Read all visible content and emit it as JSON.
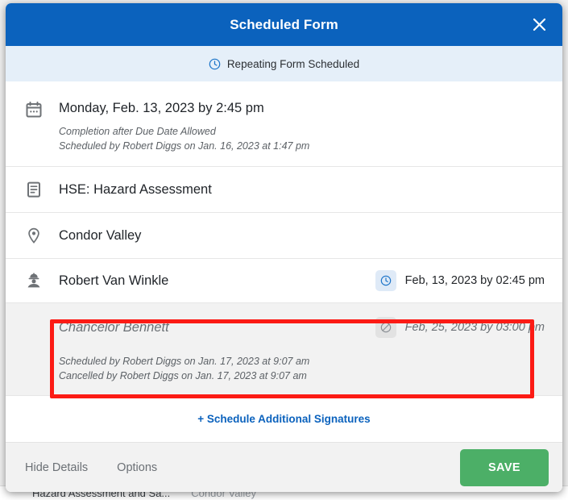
{
  "modal": {
    "title": "Scheduled Form",
    "close_icon": "close-icon",
    "status_banner": {
      "icon": "clock-icon",
      "text": "Repeating Form Scheduled"
    },
    "rows": {
      "date": {
        "icon": "calendar-icon",
        "title": "Monday, Feb. 13, 2023 by 2:45 pm",
        "note_1": "Completion after Due Date Allowed",
        "note_2": "Scheduled by Robert Diggs on Jan. 16, 2023 at 1:47 pm"
      },
      "form": {
        "icon": "form-document-icon",
        "title": "HSE: Hazard Assessment"
      },
      "location": {
        "icon": "map-pin-icon",
        "title": "Condor Valley"
      },
      "signature_active": {
        "icon": "hard-hat-worker-icon",
        "name": "Robert Van Winkle",
        "status_icon": "clock-icon",
        "stamp": "Feb, 13, 2023 by 02:45 pm"
      },
      "signature_cancelled": {
        "name": "Chancelor Bennett",
        "status_icon": "cancelled-circle-slash-icon",
        "stamp": "Feb, 25, 2023 by 03:00 pm",
        "note_1": "Scheduled by Robert Diggs on Jan. 17, 2023 at 9:07 am",
        "note_2": "Cancelled by Robert Diggs on Jan. 17, 2023 at 9:07 am"
      }
    },
    "add_signatures_label": "+ Schedule Additional Signatures",
    "footer": {
      "hide_details_label": "Hide Details",
      "options_label": "Options",
      "save_label": "SAVE"
    }
  },
  "background": {
    "row_form": "Hazard Assessment and Sa...",
    "row_location": "Condor Valley"
  },
  "colors": {
    "header_blue": "#0b62bd",
    "banner_blue": "#e5eff9",
    "link_blue": "#0b62bd",
    "save_green": "#4caf67",
    "annotation_red": "#fc1b15",
    "cancelled_grey": "#6b7075",
    "row_highlight_grey": "#f2f2f2"
  }
}
